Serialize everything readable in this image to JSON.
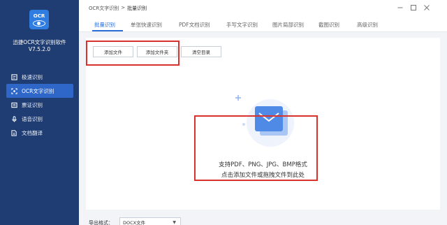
{
  "app": {
    "logo_text": "OCR",
    "name": "迅捷OCR文字识别软件",
    "version": "V7.5.2.0"
  },
  "sidebar": {
    "items": [
      {
        "label": "极速识别",
        "icon": "speed-scan-icon"
      },
      {
        "label": "OCR文字识别",
        "icon": "ocr-scan-icon",
        "active": true
      },
      {
        "label": "票证识别",
        "icon": "ticket-icon"
      },
      {
        "label": "语音识别",
        "icon": "microphone-icon"
      },
      {
        "label": "文档翻译",
        "icon": "translate-doc-icon"
      }
    ]
  },
  "breadcrumb": {
    "parent": "OCR文字识别",
    "separator": ">",
    "current": "批量识别"
  },
  "window_controls": [
    "minimize-icon",
    "restore-icon",
    "close-icon"
  ],
  "tabs": [
    {
      "label": "批量识别",
      "active": true
    },
    {
      "label": "单张快速识别"
    },
    {
      "label": "PDF文档识别"
    },
    {
      "label": "手写文字识别"
    },
    {
      "label": "图片局部识别"
    },
    {
      "label": "截图识别"
    },
    {
      "label": "高级识别"
    }
  ],
  "toolbar": {
    "add_file": "添加文件",
    "add_folder": "添加文件夹",
    "clear_list": "清空目录"
  },
  "dropzone": {
    "formats_text": "支持PDF、PNG、JPG、BMP格式",
    "hint_text": "点击添加文件或拖拽文件到此处"
  },
  "footer": {
    "output_format_label": "导出格式：",
    "output_format_value": "DOCX文件"
  },
  "colors": {
    "sidebar_bg": "#1f3d72",
    "active_blue": "#2d6fd8",
    "highlight_red": "#d9312b"
  }
}
